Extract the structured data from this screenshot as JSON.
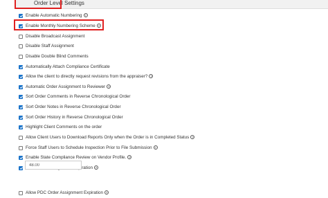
{
  "section": {
    "title": "Order Level Settings"
  },
  "settings": [
    {
      "label": "Enable Automatic Numbering",
      "checked": true
    },
    {
      "label": "Enable Monthly Numbering Scheme",
      "checked": true
    },
    {
      "label": "Disable Broadcast Assignment",
      "checked": false
    },
    {
      "label": "Disable Staff Assignment",
      "checked": false
    },
    {
      "label": "Disable Double Blind Comments",
      "checked": false
    },
    {
      "label": "Automatically Attach Compliance Certificate",
      "checked": true
    },
    {
      "label": "Allow the client to directly request revisions from the appraiser?",
      "checked": true
    },
    {
      "label": "Automatic Order Assignment to Reviewer",
      "checked": true
    },
    {
      "label": "Sort Order Comments in Reverse Chronological Order",
      "checked": true
    },
    {
      "label": "Sort Order Notes in Reverse Chronological Order",
      "checked": true
    },
    {
      "label": "Sort Order History in Reverse Chronological Order",
      "checked": true
    },
    {
      "label": "Highlight Client Comments on the order",
      "checked": true
    },
    {
      "label": "Allow Client Users to Download Reports Only when the Order is in Completed Status",
      "checked": false
    },
    {
      "label": "Force Staff Users to Schedule Inspection Prior to File Submission",
      "checked": false
    },
    {
      "label": "Enable State Compliance Review on Vendor Profile.",
      "checked": true
    },
    {
      "label": "Allow Order Assignment Expiration",
      "checked": true
    },
    {
      "label": "Allow PDC Order Assignment Expiration",
      "checked": false
    }
  ],
  "expiration_input": {
    "value": "48.00"
  },
  "help_glyph": "?",
  "colors": {
    "highlight": "#e02020",
    "checkbox_checked": "#1a73c9"
  }
}
